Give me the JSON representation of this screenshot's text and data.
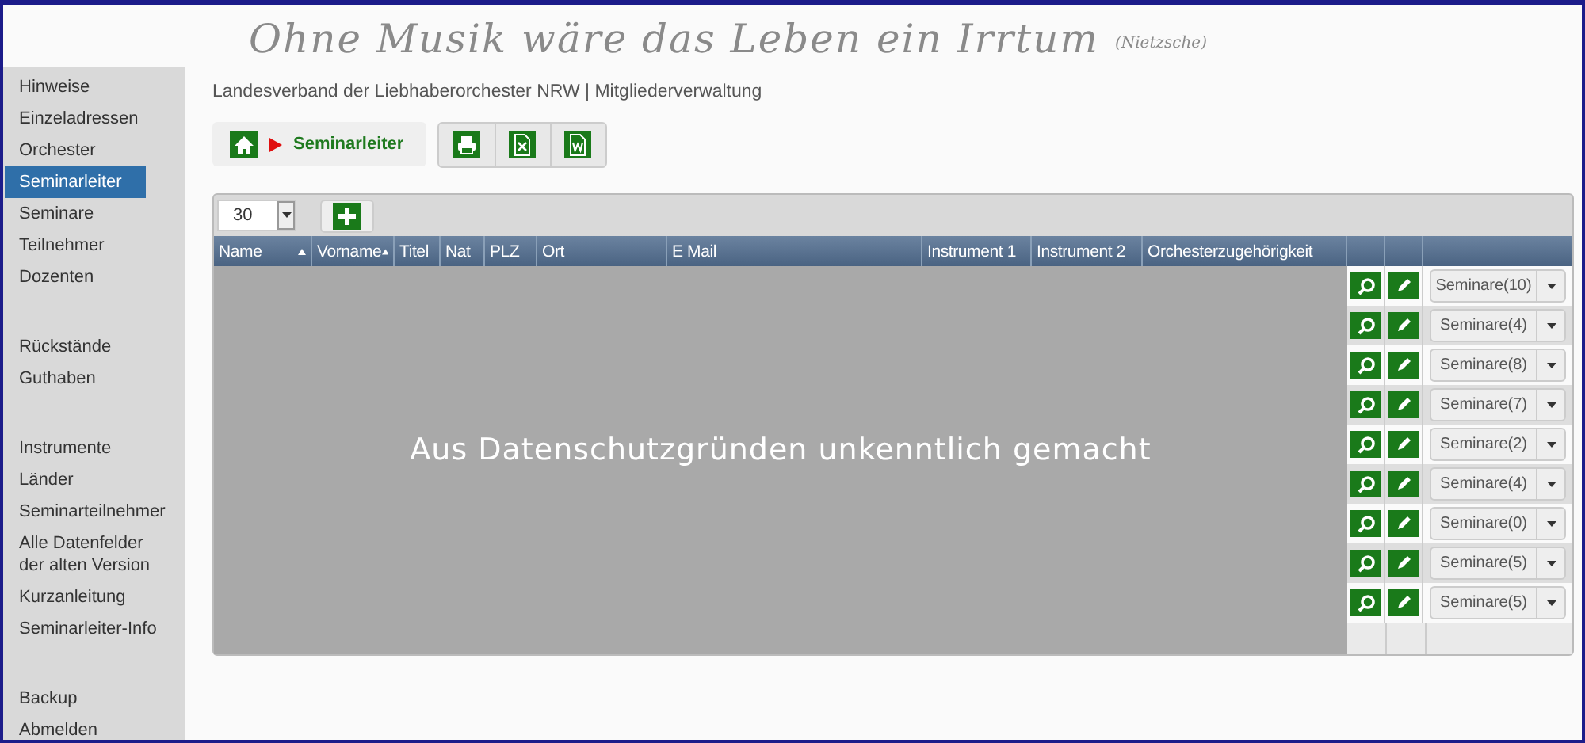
{
  "header": {
    "motto": "Ohne Musik wäre das Leben ein Irrtum",
    "attribution": "(Nietzsche)"
  },
  "sidebar": {
    "items": [
      {
        "kind": "link",
        "label": "Hinweise",
        "selected": false
      },
      {
        "kind": "link",
        "label": "Einzeladressen",
        "selected": false
      },
      {
        "kind": "link",
        "label": "Orchester",
        "selected": false
      },
      {
        "kind": "link",
        "label": "Seminarleiter",
        "selected": true
      },
      {
        "kind": "link",
        "label": "Seminare",
        "selected": false
      },
      {
        "kind": "link",
        "label": "Teilnehmer",
        "selected": false
      },
      {
        "kind": "link",
        "label": "Dozenten",
        "selected": false
      },
      {
        "kind": "separator"
      },
      {
        "kind": "link",
        "label": "Rückstände",
        "selected": false
      },
      {
        "kind": "link",
        "label": "Guthaben",
        "selected": false
      },
      {
        "kind": "separator"
      },
      {
        "kind": "link",
        "label": "Instrumente",
        "selected": false
      },
      {
        "kind": "link",
        "label": "Länder",
        "selected": false
      },
      {
        "kind": "link",
        "label": "Seminarteilnehmer",
        "selected": false
      },
      {
        "kind": "link",
        "label": "Alle Datenfelder der alten Version",
        "selected": false
      },
      {
        "kind": "link",
        "label": "Kurzanleitung",
        "selected": false
      },
      {
        "kind": "link",
        "label": "Seminarleiter-Info",
        "selected": false
      },
      {
        "kind": "separator"
      },
      {
        "kind": "link",
        "label": "Backup",
        "selected": false
      },
      {
        "kind": "link",
        "label": "Abmelden",
        "selected": false
      }
    ]
  },
  "breadcrumb_title": "Landesverband der Liebhaberorchester NRW | Mitgliederverwaltung",
  "breadcrumb": {
    "current": "Seminarleiter"
  },
  "export_buttons": [
    {
      "kind": "print"
    },
    {
      "kind": "excel"
    },
    {
      "kind": "word"
    }
  ],
  "page_size": {
    "value": "30"
  },
  "table": {
    "columns": [
      {
        "label": "Name",
        "sorted": true
      },
      {
        "label": "Vorname",
        "sorted": true
      },
      {
        "label": "Titel",
        "sorted": false
      },
      {
        "label": "Nat",
        "sorted": false
      },
      {
        "label": "PLZ",
        "sorted": false
      },
      {
        "label": "Ort",
        "sorted": false
      },
      {
        "label": "E Mail",
        "sorted": false
      },
      {
        "label": "Instrument 1",
        "sorted": false
      },
      {
        "label": "Instrument 2",
        "sorted": false
      },
      {
        "label": "Orchesterzugehörigkeit",
        "sorted": false
      }
    ],
    "redaction_notice": "Aus Datenschutzgründen unkenntlich gemacht",
    "rows": [
      {
        "seminars": "Seminare(10)"
      },
      {
        "seminars": "Seminare(4)"
      },
      {
        "seminars": "Seminare(8)"
      },
      {
        "seminars": "Seminare(7)"
      },
      {
        "seminars": "Seminare(2)"
      },
      {
        "seminars": "Seminare(4)"
      },
      {
        "seminars": "Seminare(0)"
      },
      {
        "seminars": "Seminare(5)"
      },
      {
        "seminars": "Seminare(5)"
      }
    ]
  }
}
